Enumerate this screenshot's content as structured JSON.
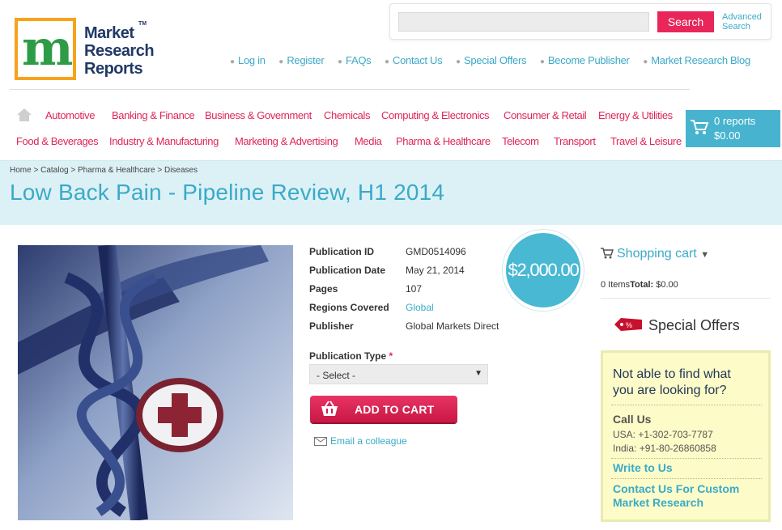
{
  "header": {
    "logo": {
      "line1": "Market",
      "line2": "Research",
      "line3": "Reports",
      "tm": "TM",
      "mark": "m"
    },
    "search": {
      "placeholder": "",
      "button": "Search",
      "advanced_line1": "Advanced",
      "advanced_line2": "Search"
    },
    "links": [
      "Log in",
      "Register",
      "FAQs",
      "Contact Us",
      "Special Offers",
      "Become Publisher",
      "Market Research Blog"
    ]
  },
  "nav": {
    "row1": [
      "Automotive",
      "Banking & Finance",
      "Business & Government",
      "Chemicals",
      "Computing & Electronics",
      "Consumer & Retail",
      "Energy & Utilities"
    ],
    "row2": [
      "Food & Beverages",
      "Industry & Manufacturing",
      "Marketing & Advertising",
      "Media",
      "Pharma & Healthcare",
      "Telecom",
      "Transport",
      "Travel & Leisure"
    ],
    "cart": {
      "reports": "0 reports",
      "amount": "$0.00"
    }
  },
  "breadcrumb": [
    "Home",
    "Catalog",
    "Pharma & Healthcare",
    "Diseases"
  ],
  "breadcrumb_sep": ">",
  "page_title": "Low Back Pain - Pipeline Review, H1 2014",
  "product": {
    "price": "$2,000.00",
    "details": [
      {
        "label": "Publication ID",
        "value": "GMD0514096"
      },
      {
        "label": "Publication Date",
        "value": "May 21, 2014"
      },
      {
        "label": "Pages",
        "value": "107"
      },
      {
        "label": "Regions Covered",
        "value": "Global"
      },
      {
        "label": "Publisher",
        "value": "Global Markets Direct"
      }
    ],
    "publication_type_label": "Publication Type",
    "required_mark": "*",
    "select_value": "- Select -",
    "add_to_cart": "ADD TO CART",
    "email_colleague": "Email a colleague"
  },
  "sidebar": {
    "shopping_cart_title": "Shopping cart",
    "items_label": "0 Items",
    "total_label": "Total:",
    "total_value": "$0.00",
    "special_offers": "Special Offers",
    "help": {
      "question_line1": "Not able to find what",
      "question_line2": "you are looking for?",
      "call_us": "Call Us",
      "phone_usa": "USA: +1-302-703-7787",
      "phone_india": "India: +91-80-26860858",
      "write_to_us": "Write to Us",
      "custom_line1": "Contact Us For Custom",
      "custom_line2": "Market Research"
    }
  },
  "colors": {
    "accent": "#3aaac8",
    "brand_pink": "#e0255a",
    "cart_blue": "#47b3cf",
    "help_bg": "#fdfbc8"
  }
}
